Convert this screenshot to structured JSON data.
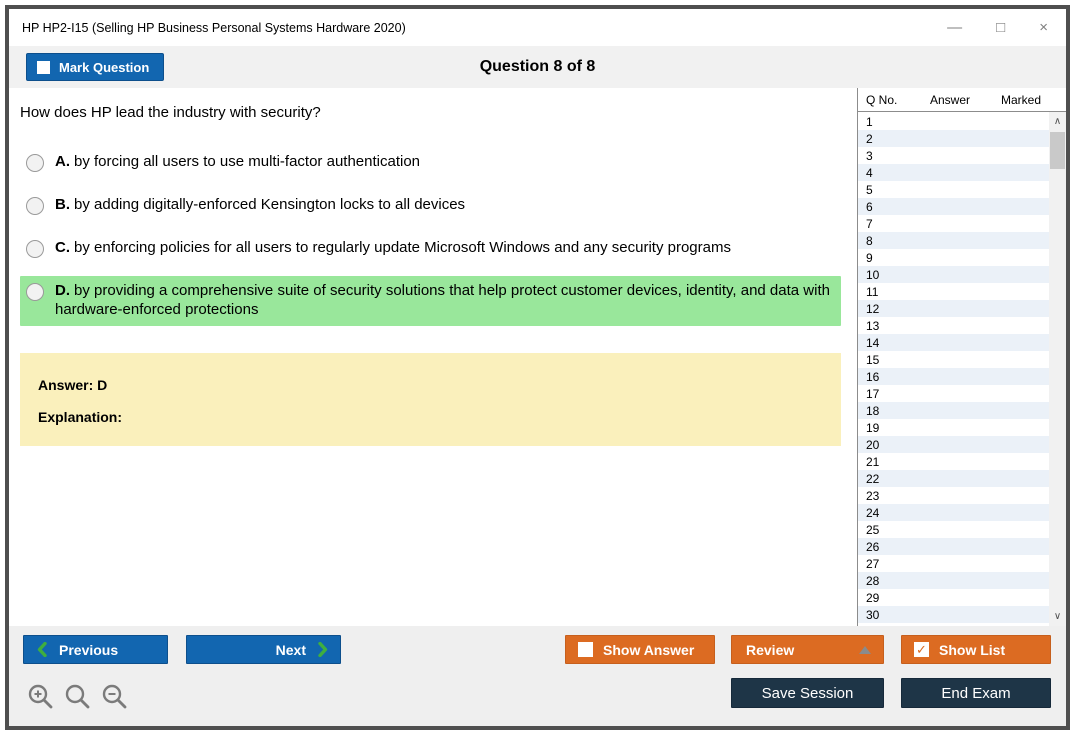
{
  "window": {
    "title": "HP HP2-I15 (Selling HP Business Personal Systems Hardware 2020)",
    "controls": {
      "minimize": "—",
      "maximize": "□",
      "close": "×"
    }
  },
  "header": {
    "mark_question_label": "Mark Question",
    "question_counter": "Question 8 of 8"
  },
  "question": {
    "text": "How does HP lead the industry with security?",
    "options": [
      {
        "letter": "A.",
        "text": "by forcing all users to use multi-factor authentication",
        "highlighted": false
      },
      {
        "letter": "B.",
        "text": "by adding digitally-enforced Kensington locks to all devices",
        "highlighted": false
      },
      {
        "letter": "C.",
        "text": "by enforcing policies for all users to regularly update Microsoft Windows and any security programs",
        "highlighted": false
      },
      {
        "letter": "D.",
        "text": "by providing a comprehensive suite of security solutions that help protect customer devices, identity, and data with hardware-enforced protections",
        "highlighted": true
      }
    ],
    "answer_label": "Answer: D",
    "explanation_label": "Explanation:"
  },
  "question_list": {
    "columns": [
      "Q No.",
      "Answer",
      "Marked"
    ],
    "rows": [
      "1",
      "2",
      "3",
      "4",
      "5",
      "6",
      "7",
      "8",
      "9",
      "10",
      "11",
      "12",
      "13",
      "14",
      "15",
      "16",
      "17",
      "18",
      "19",
      "20",
      "21",
      "22",
      "23",
      "24",
      "25",
      "26",
      "27",
      "28",
      "29",
      "30"
    ],
    "scroll_up_glyph": "∧",
    "scroll_down_glyph": "∨"
  },
  "footer": {
    "previous_label": "Previous",
    "next_label": "Next",
    "show_answer_label": "Show Answer",
    "review_label": "Review",
    "show_list_label": "Show List",
    "show_list_checked_glyph": "✓",
    "save_session_label": "Save Session",
    "end_exam_label": "End Exam"
  },
  "icons": {
    "zoom_in": "zoom-in-icon",
    "zoom_reset": "zoom-icon",
    "zoom_out": "zoom-out-icon",
    "chevron_left": "chevron-left-icon",
    "chevron_right": "chevron-right-icon"
  },
  "colors": {
    "accent_blue": "#1266b0",
    "accent_orange": "#dc6b22",
    "accent_navy": "#1e3547",
    "highlight_green": "#99e79b",
    "answer_yellow": "#faf0bc",
    "row_alt_blue": "#ebf1f8",
    "chevron_green": "#3fae3f"
  }
}
